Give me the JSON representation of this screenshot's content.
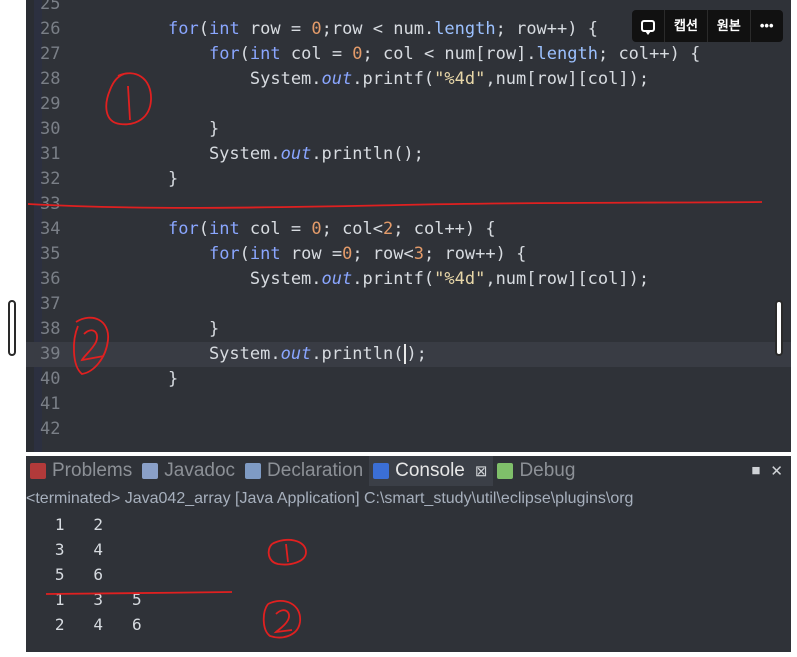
{
  "editor": {
    "lines": [
      {
        "n": "25",
        "code": ""
      },
      {
        "n": "26",
        "code": "for_outer_row"
      },
      {
        "n": "27",
        "code": "for_inner_col"
      },
      {
        "n": "28",
        "code": "printf"
      },
      {
        "n": "29",
        "code": ""
      },
      {
        "n": "30",
        "code": "close1"
      },
      {
        "n": "31",
        "code": "println"
      },
      {
        "n": "32",
        "code": "close0"
      },
      {
        "n": "33",
        "code": ""
      },
      {
        "n": "34",
        "code": "for_outer_col"
      },
      {
        "n": "35",
        "code": "for_inner_row"
      },
      {
        "n": "36",
        "code": "printf"
      },
      {
        "n": "37",
        "code": ""
      },
      {
        "n": "38",
        "code": "close1"
      },
      {
        "n": "39",
        "code": "println_caret"
      },
      {
        "n": "40",
        "code": "close0"
      },
      {
        "n": "41",
        "code": ""
      },
      {
        "n": "42",
        "code": ""
      }
    ],
    "tokens": {
      "for": "for",
      "int": "int",
      "row": "row",
      "col": "col",
      "num": "num",
      "length": "length",
      "System": "System.",
      "out": "out",
      "printf": ".printf(",
      "println": ".println(",
      "fmt": "\"%4d\"",
      "zero": "0",
      "two": "2",
      "three": "3"
    }
  },
  "overlay_toolbar": {
    "caption": "캡션",
    "original": "원본",
    "more": "•••"
  },
  "panel": {
    "tabs": [
      {
        "label": "Problems",
        "icon": "problems-icon",
        "color": "#b23a3a"
      },
      {
        "label": "Javadoc",
        "icon": "javadoc-icon",
        "color": "#8aa0c8"
      },
      {
        "label": "Declaration",
        "icon": "declaration-icon",
        "color": "#7f9bc4"
      },
      {
        "label": "Console",
        "icon": "console-icon",
        "color": "#3b6fd6",
        "active": true
      },
      {
        "label": "Debug",
        "icon": "debug-icon",
        "color": "#7fbf6a"
      }
    ],
    "close_glyph": "⊠",
    "status": "<terminated> Java042_array [Java Application] C:\\smart_study\\util\\eclipse\\plugins\\org",
    "output": [
      "   1   2",
      "   3   4",
      "   5   6",
      "   1   3   5",
      "   2   4   6"
    ]
  }
}
